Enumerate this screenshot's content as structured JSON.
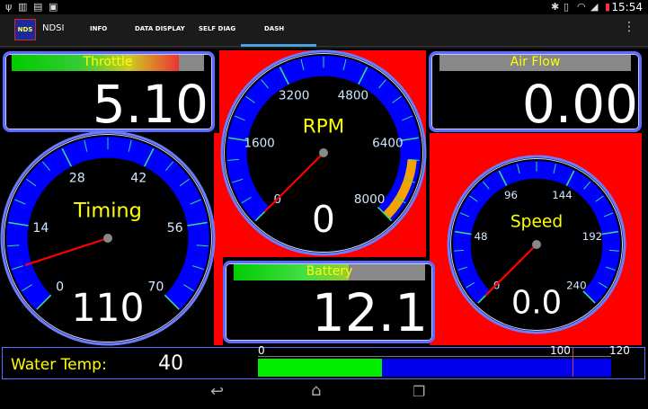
{
  "status_bar": {
    "clock": "15:54",
    "icons": [
      "usb-icon",
      "sim-icon",
      "clipboard-icon",
      "image-icon",
      "bluetooth-icon",
      "vibrate-icon",
      "wifi-icon",
      "signal-icon",
      "battery-icon"
    ]
  },
  "action_bar": {
    "app_icon_text": "NDS",
    "app_title": "NDSI",
    "tabs": [
      {
        "label": "INFO"
      },
      {
        "label": "DATA DISPLAY"
      },
      {
        "label": "SELF DIAG"
      },
      {
        "label": "DASH"
      }
    ],
    "active_tab": "DASH"
  },
  "dash": {
    "throttle": {
      "label": "Throttle",
      "value": "5.10",
      "fill": 0.87
    },
    "air_flow": {
      "label": "Air Flow",
      "value": "0.00",
      "fill": 0
    },
    "battery": {
      "label": "Battery",
      "value": "12.1",
      "fill": 0.6
    },
    "rpm": {
      "label": "RPM",
      "value": "0",
      "ticks": [
        "0",
        "1600",
        "3200",
        "4800",
        "6400",
        "8000"
      ],
      "redline_from": 6800,
      "max": 8000,
      "needle": 0
    },
    "timing": {
      "label": "Timing",
      "value": "110",
      "ticks": [
        "0",
        "14",
        "28",
        "42",
        "56",
        "70"
      ],
      "max": 70,
      "needle": 7
    },
    "speed": {
      "label": "Speed",
      "value": "0.0",
      "ticks": [
        "0",
        "48",
        "96",
        "144",
        "192",
        "240"
      ],
      "max": 240,
      "needle": 0
    },
    "water_temp": {
      "label": "Water Temp:",
      "value": "40",
      "scale_min": "0",
      "scale_mid": "100",
      "scale_max": "120",
      "fill": 0.35
    }
  },
  "colors": {
    "gauge_fill": "#0000ff",
    "bezel": "#5b6bff",
    "needle": "#ff0000",
    "label_yellow": "#ffff00",
    "bar_green": "#00ff00",
    "warning_orange": "#f5a300"
  }
}
